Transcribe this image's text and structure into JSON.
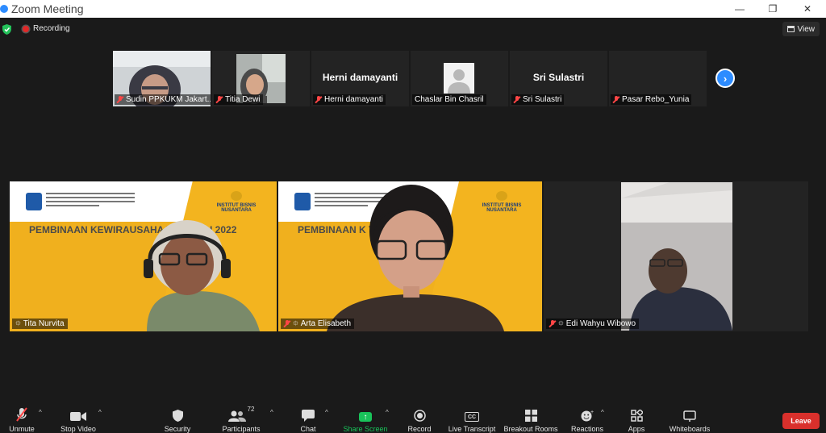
{
  "window": {
    "title": "Zoom Meeting",
    "minimize_icon": "minimize-icon",
    "maximize_icon": "restore-icon",
    "close_icon": "close-icon"
  },
  "topbar": {
    "recording_label": "Recording",
    "view_label": "View"
  },
  "filmstrip": [
    {
      "name": "Sudin PPKUKM Jakart...",
      "video": true,
      "muted": true
    },
    {
      "name": "Titia Dewi",
      "video": true,
      "muted": true
    },
    {
      "name": "Herni damayanti",
      "display_name": "Herni damayanti",
      "video": false,
      "muted": true
    },
    {
      "name": "Chaslar Bin Chasril",
      "video": false,
      "muted": false,
      "avatar": "default-avatar"
    },
    {
      "name": "Sri Sulastri",
      "display_name": "Sri Sulastri",
      "video": false,
      "muted": true
    },
    {
      "name": "Pasar Rebo_Yunia",
      "video": false,
      "muted": true
    }
  ],
  "main_tiles": [
    {
      "name": "Tita Nurvita",
      "pinned": true,
      "muted": false,
      "active_speaker": true,
      "slide_title": "PEMBINAAN KEWIRAUSAHA          TERPADU 2022"
    },
    {
      "name": "Arta Elisabeth",
      "pinned": true,
      "muted": true,
      "active_speaker": false,
      "slide_title": "PEMBINAAN K                   TERPADU 2022"
    },
    {
      "name": "Edi Wahyu Wibowo",
      "pinned": true,
      "muted": true,
      "active_speaker": false
    }
  ],
  "slide": {
    "org_right": "INSTITUT BISNIS NUSANTARA"
  },
  "toolbar": {
    "unmute": "Unmute",
    "stop_video": "Stop Video",
    "security": "Security",
    "participants": "Participants",
    "participants_count": "72",
    "chat": "Chat",
    "share_screen": "Share Screen",
    "record": "Record",
    "live_transcript": "Live Transcript",
    "breakout_rooms": "Breakout Rooms",
    "reactions": "Reactions",
    "apps": "Apps",
    "whiteboards": "Whiteboards",
    "leave": "Leave"
  },
  "colors": {
    "background": "#1a1a1a",
    "accent_blue": "#2d8cff",
    "share_green": "#19c35a",
    "leave_red": "#d9302c",
    "active_speaker": "#f7e016",
    "slide_yellow": "#f0b01e"
  }
}
